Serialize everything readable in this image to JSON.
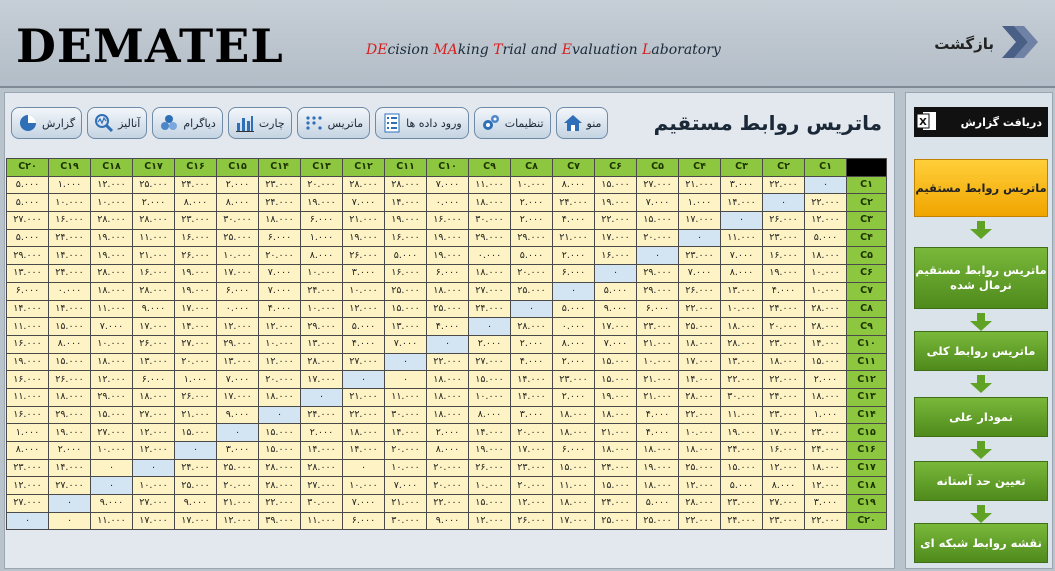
{
  "header": {
    "logo": "DEMATEL",
    "subtitle_parts": [
      {
        "t": "DE",
        "hl": true
      },
      {
        "t": "cision ",
        "hl": false
      },
      {
        "t": "MA",
        "hl": true
      },
      {
        "t": "king ",
        "hl": false
      },
      {
        "t": "T",
        "hl": true
      },
      {
        "t": "rial and ",
        "hl": false
      },
      {
        "t": "E",
        "hl": true
      },
      {
        "t": "valuation ",
        "hl": false
      },
      {
        "t": "L",
        "hl": true
      },
      {
        "t": "aboratory",
        "hl": false
      }
    ],
    "back_label": "بازگشت",
    "highlight_color": "#d81e1e"
  },
  "toolbar": [
    {
      "label": "منو",
      "icon": "home-icon"
    },
    {
      "label": "تنظیمات",
      "icon": "gears-icon"
    },
    {
      "label": "ورود داده ها",
      "icon": "form-icon"
    },
    {
      "label": "ماتریس",
      "icon": "matrix-dots-icon"
    },
    {
      "label": "چارت",
      "icon": "bar-chart-icon"
    },
    {
      "label": "دیاگرام",
      "icon": "diagram-icon"
    },
    {
      "label": "آنالیز",
      "icon": "analysis-icon"
    },
    {
      "label": "گزارش",
      "icon": "pie-chart-icon"
    }
  ],
  "page_title": "ماتریس روابط مستقیم",
  "sidebar": {
    "report_label": "دریافت گزارش",
    "steps": [
      {
        "label": "ماتریس روابط مستقیم",
        "active": true
      },
      {
        "label": "ماتریس روابط مستقیم نرمال شده",
        "active": false
      },
      {
        "label": "ماتریس روابط کلی",
        "active": false
      },
      {
        "label": "نمودار علی",
        "active": false
      },
      {
        "label": "تعیین حد آستانه",
        "active": false
      },
      {
        "label": "نقشه روابط شبکه ای",
        "active": false
      }
    ]
  },
  "matrix": {
    "columns": [
      "C۱",
      "C۲",
      "C۳",
      "C۴",
      "C۵",
      "C۶",
      "C۷",
      "C۸",
      "C۹",
      "C۱۰",
      "C۱۱",
      "C۱۲",
      "C۱۳",
      "C۱۴",
      "C۱۵",
      "C۱۶",
      "C۱۷",
      "C۱۸",
      "C۱۹",
      "C۲۰"
    ],
    "rows": [
      {
        "label": "C۱",
        "values": [
          "۰",
          "۲۲.۰۰۰",
          "۳.۰۰۰",
          "۲۱.۰۰۰",
          "۲۷.۰۰۰",
          "۱۵.۰۰۰",
          "۸.۰۰۰",
          "۱۰.۰۰۰",
          "۱۱.۰۰۰",
          "۷.۰۰۰",
          "۲۸.۰۰۰",
          "۲۸.۰۰۰",
          "۲۰.۰۰۰",
          "۲۳.۰۰۰",
          "۲.۰۰۰",
          "۲۴.۰۰۰",
          "۲۵.۰۰۰",
          "۱۲.۰۰۰",
          "۱.۰۰۰",
          "۵.۰۰۰"
        ]
      },
      {
        "label": "C۲",
        "values": [
          "۲۲.۰۰۰",
          "۰",
          "۱۴.۰۰۰",
          "۱.۰۰۰",
          "۷.۰۰۰",
          "۱۹.۰۰۰",
          "۲۴.۰۰۰",
          "۲.۰۰۰",
          "۱۸.۰۰۰",
          "۰.۰۰۰",
          "۱۴.۰۰۰",
          "۷.۰۰۰",
          "۱۹.۰۰۰",
          "۲۴.۰۰۰",
          "۸.۰۰۰",
          "۸.۰۰۰",
          "۲.۰۰۰",
          "۱۰.۰۰۰",
          "۱۰.۰۰۰",
          "۵.۰۰۰"
        ]
      },
      {
        "label": "C۳",
        "values": [
          "۱۲.۰۰۰",
          "۲۶.۰۰۰",
          "۰",
          "۱۷.۰۰۰",
          "۱۵.۰۰۰",
          "۲۲.۰۰۰",
          "۴.۰۰۰",
          "۲.۰۰۰",
          "۳۰.۰۰۰",
          "۱۶.۰۰۰",
          "۱۹.۰۰۰",
          "۲۱.۰۰۰",
          "۶.۰۰۰",
          "۱۸.۰۰۰",
          "۳۰.۰۰۰",
          "۲۳.۰۰۰",
          "۲۸.۰۰۰",
          "۲۸.۰۰۰",
          "۱۶.۰۰۰",
          "۲۷.۰۰۰"
        ]
      },
      {
        "label": "C۴",
        "values": [
          "۵.۰۰۰",
          "۲۳.۰۰۰",
          "۱۱.۰۰۰",
          "۰",
          "۲۰.۰۰۰",
          "۱۷.۰۰۰",
          "۲۱.۰۰۰",
          "۲۹.۰۰۰",
          "۲۹.۰۰۰",
          "۱۹.۰۰۰",
          "۱۶.۰۰۰",
          "۱۹.۰۰۰",
          "۱.۰۰۰",
          "۶.۰۰۰",
          "۲۵.۰۰۰",
          "۱۶.۰۰۰",
          "۱۱.۰۰۰",
          "۱۹.۰۰۰",
          "۲۴.۰۰۰",
          "۵.۰۰۰"
        ]
      },
      {
        "label": "C۵",
        "values": [
          "۱۸.۰۰۰",
          "۱۶.۰۰۰",
          "۷.۰۰۰",
          "۲۳.۰۰۰",
          "۰",
          "۱۶.۰۰۰",
          "۲.۰۰۰",
          "۵.۰۰۰",
          "۰.۰۰۰",
          "۱۹.۰۰۰",
          "۵.۰۰۰",
          "۲۶.۰۰۰",
          "۸.۰۰۰",
          "۲۰.۰۰۰",
          "۱۰.۰۰۰",
          "۲۶.۰۰۰",
          "۲۱.۰۰۰",
          "۱۹.۰۰۰",
          "۱۴.۰۰۰",
          "۲۹.۰۰۰"
        ]
      },
      {
        "label": "C۶",
        "values": [
          "۱۰.۰۰۰",
          "۱۹.۰۰۰",
          "۸.۰۰۰",
          "۷.۰۰۰",
          "۲۹.۰۰۰",
          "۰",
          "۶.۰۰۰",
          "۲۰.۰۰۰",
          "۱۸.۰۰۰",
          "۶.۰۰۰",
          "۱۶.۰۰۰",
          "۳.۰۰۰",
          "۱۰.۰۰۰",
          "۷.۰۰۰",
          "۱۷.۰۰۰",
          "۱۹.۰۰۰",
          "۱۶.۰۰۰",
          "۲۸.۰۰۰",
          "۲۴.۰۰۰",
          "۱۳.۰۰۰"
        ]
      },
      {
        "label": "C۷",
        "values": [
          "۱۰.۰۰۰",
          "۴.۰۰۰",
          "۱۳.۰۰۰",
          "۲۶.۰۰۰",
          "۲۹.۰۰۰",
          "۵.۰۰۰",
          "۰",
          "۲۵.۰۰۰",
          "۲۷.۰۰۰",
          "۱۸.۰۰۰",
          "۲۵.۰۰۰",
          "۱۰.۰۰۰",
          "۲۴.۰۰۰",
          "۷.۰۰۰",
          "۶.۰۰۰",
          "۱۹.۰۰۰",
          "۲۸.۰۰۰",
          "۱۸.۰۰۰",
          "۰.۰۰۰",
          "۶.۰۰۰"
        ]
      },
      {
        "label": "C۸",
        "values": [
          "۲۸.۰۰۰",
          "۲۴.۰۰۰",
          "۱۰.۰۰۰",
          "۲۲.۰۰۰",
          "۶.۰۰۰",
          "۹.۰۰۰",
          "۵.۰۰۰",
          "۰",
          "۲۴.۰۰۰",
          "۲۵.۰۰۰",
          "۱۵.۰۰۰",
          "۱۲.۰۰۰",
          "۱۰.۰۰۰",
          "۴.۰۰۰",
          "۰.۰۰۰",
          "۱۷.۰۰۰",
          "۹.۰۰۰",
          "۱۱.۰۰۰",
          "۱۴.۰۰۰",
          "۱۴.۰۰۰"
        ]
      },
      {
        "label": "C۹",
        "values": [
          "۲۸.۰۰۰",
          "۲۰.۰۰۰",
          "۱۸.۰۰۰",
          "۲۵.۰۰۰",
          "۲۳.۰۰۰",
          "۱۷.۰۰۰",
          "۰.۰۰۰",
          "۲۸.۰۰۰",
          "۰",
          "۴.۰۰۰",
          "۱۳.۰۰۰",
          "۵.۰۰۰",
          "۲۹.۰۰۰",
          "۱۲.۰۰۰",
          "۱۲.۰۰۰",
          "۱۴.۰۰۰",
          "۱۷.۰۰۰",
          "۷.۰۰۰",
          "۱۵.۰۰۰",
          "۱۱.۰۰۰"
        ]
      },
      {
        "label": "C۱۰",
        "values": [
          "۱۴.۰۰۰",
          "۲۳.۰۰۰",
          "۲۸.۰۰۰",
          "۱۸.۰۰۰",
          "۲۱.۰۰۰",
          "۷.۰۰۰",
          "۸.۰۰۰",
          "۲.۰۰۰",
          "۲.۰۰۰",
          "۰",
          "۷.۰۰۰",
          "۴.۰۰۰",
          "۱۳.۰۰۰",
          "۱۰.۰۰۰",
          "۲۹.۰۰۰",
          "۲۷.۰۰۰",
          "۲۶.۰۰۰",
          "۱۰.۰۰۰",
          "۸.۰۰۰",
          "۱۶.۰۰۰"
        ]
      },
      {
        "label": "C۱۱",
        "values": [
          "۱۵.۰۰۰",
          "۱۸.۰۰۰",
          "۱۳.۰۰۰",
          "۱۷.۰۰۰",
          "۱۰.۰۰۰",
          "۱۵.۰۰۰",
          "۲.۰۰۰",
          "۴.۰۰۰",
          "۲۷.۰۰۰",
          "۲۲.۰۰۰",
          "۰",
          "۲۷.۰۰۰",
          "۲۸.۰۰۰",
          "۱۲.۰۰۰",
          "۱۳.۰۰۰",
          "۲۰.۰۰۰",
          "۱۳.۰۰۰",
          "۱۸.۰۰۰",
          "۱۵.۰۰۰",
          "۱۹.۰۰۰"
        ]
      },
      {
        "label": "C۱۲",
        "values": [
          "۲.۰۰۰",
          "۲۲.۰۰۰",
          "۲۲.۰۰۰",
          "۱۴.۰۰۰",
          "۲۱.۰۰۰",
          "۱۵.۰۰۰",
          "۲۳.۰۰۰",
          "۱۴.۰۰۰",
          "۱۵.۰۰۰",
          "۱۸.۰۰۰",
          "۰",
          "۰",
          "۱۷.۰۰۰",
          "۲۰.۰۰۰",
          "۷.۰۰۰",
          "۱.۰۰۰",
          "۶.۰۰۰",
          "۱۲.۰۰۰",
          "۲۶.۰۰۰",
          "۱۶.۰۰۰"
        ]
      },
      {
        "label": "C۱۳",
        "values": [
          "۱۸.۰۰۰",
          "۲۴.۰۰۰",
          "۳۰.۰۰۰",
          "۲۸.۰۰۰",
          "۲۱.۰۰۰",
          "۱۹.۰۰۰",
          "۲.۰۰۰",
          "۱۴.۰۰۰",
          "۱۰.۰۰۰",
          "۱۸.۰۰۰",
          "۱۱.۰۰۰",
          "۲۱.۰۰۰",
          "۰",
          "۱۸.۰۰۰",
          "۱۷.۰۰۰",
          "۲۶.۰۰۰",
          "۱۸.۰۰۰",
          "۲۹.۰۰۰",
          "۱۸.۰۰۰",
          "۱۱.۰۰۰"
        ]
      },
      {
        "label": "C۱۴",
        "values": [
          "۱.۰۰۰",
          "۲۳.۰۰۰",
          "۱۱.۰۰۰",
          "۲۲.۰۰۰",
          "۴.۰۰۰",
          "۱۸.۰۰۰",
          "۱۸.۰۰۰",
          "۳.۰۰۰",
          "۸.۰۰۰",
          "۱۸.۰۰۰",
          "۳۰.۰۰۰",
          "۲۲.۰۰۰",
          "۲۴.۰۰۰",
          "۰",
          "۹.۰۰۰",
          "۲۱.۰۰۰",
          "۲۷.۰۰۰",
          "۱۵.۰۰۰",
          "۲۹.۰۰۰",
          "۱۶.۰۰۰"
        ]
      },
      {
        "label": "C۱۵",
        "values": [
          "۲۳.۰۰۰",
          "۱۷.۰۰۰",
          "۱۹.۰۰۰",
          "۱۰.۰۰۰",
          "۴.۰۰۰",
          "۲۱.۰۰۰",
          "۱۸.۰۰۰",
          "۲۰.۰۰۰",
          "۱۴.۰۰۰",
          "۲.۰۰۰",
          "۱۴.۰۰۰",
          "۱۸.۰۰۰",
          "۲.۰۰۰",
          "۱۵.۰۰۰",
          "۰",
          "۱۵.۰۰۰",
          "۱۲.۰۰۰",
          "۲۷.۰۰۰",
          "۱۹.۰۰۰",
          "۱.۰۰۰"
        ]
      },
      {
        "label": "C۱۶",
        "values": [
          "۲۴.۰۰۰",
          "۱۶.۰۰۰",
          "۲۴.۰۰۰",
          "۱۸.۰۰۰",
          "۱۸.۰۰۰",
          "۱۸.۰۰۰",
          "۶.۰۰۰",
          "۱۷.۰۰۰",
          "۱۹.۰۰۰",
          "۸.۰۰۰",
          "۲۰.۰۰۰",
          "۱۴.۰۰۰",
          "۱۴.۰۰۰",
          "۱۵.۰۰۰",
          "۳.۰۰۰",
          "۰",
          "۱۲.۰۰۰",
          "۱۰.۰۰۰",
          "۲.۰۰۰",
          "۸.۰۰۰"
        ]
      },
      {
        "label": "C۱۷",
        "values": [
          "۱۸.۰۰۰",
          "۱۲.۰۰۰",
          "۱۵.۰۰۰",
          "۲۵.۰۰۰",
          "۱۹.۰۰۰",
          "۲۴.۰۰۰",
          "۱۵.۰۰۰",
          "۲۳.۰۰۰",
          "۲۶.۰۰۰",
          "۲۰.۰۰۰",
          "۱۰.۰۰۰",
          "۰",
          "۲۸.۰۰۰",
          "۲۸.۰۰۰",
          "۲۵.۰۰۰",
          "۲۴.۰۰۰",
          "۰",
          "۰",
          "۱۴.۰۰۰",
          "۲۳.۰۰۰"
        ]
      },
      {
        "label": "C۱۸",
        "values": [
          "۱۲.۰۰۰",
          "۸.۰۰۰",
          "۵.۰۰۰",
          "۱۲.۰۰۰",
          "۱۸.۰۰۰",
          "۱۵.۰۰۰",
          "۱۱.۰۰۰",
          "۲۰.۰۰۰",
          "۱۰.۰۰۰",
          "۲۰.۰۰۰",
          "۷.۰۰۰",
          "۱۰.۰۰۰",
          "۲۷.۰۰۰",
          "۲۸.۰۰۰",
          "۲۰.۰۰۰",
          "۲۵.۰۰۰",
          "۱۰.۰۰۰",
          "۰",
          "۲۷.۰۰۰",
          "۱۲.۰۰۰"
        ]
      },
      {
        "label": "C۱۹",
        "values": [
          "۳.۰۰۰",
          "۲۷.۰۰۰",
          "۲۳.۰۰۰",
          "۲۸.۰۰۰",
          "۵.۰۰۰",
          "۲۴.۰۰۰",
          "۱۸.۰۰۰",
          "۱۲.۰۰۰",
          "۱۵.۰۰۰",
          "۲۲.۰۰۰",
          "۲۱.۰۰۰",
          "۷.۰۰۰",
          "۳۰.۰۰۰",
          "۲۲.۰۰۰",
          "۲۱.۰۰۰",
          "۹.۰۰۰",
          "۲۷.۰۰۰",
          "۹.۰۰۰",
          "۰",
          "۲۷.۰۰۰"
        ]
      },
      {
        "label": "C۲۰",
        "values": [
          "۲۲.۰۰۰",
          "۲۳.۰۰۰",
          "۲۴.۰۰۰",
          "۲۲.۰۰۰",
          "۲۵.۰۰۰",
          "۲۵.۰۰۰",
          "۱۷.۰۰۰",
          "۲۶.۰۰۰",
          "۱۲.۰۰۰",
          "۹.۰۰۰",
          "۳۰.۰۰۰",
          "۶.۰۰۰",
          "۱۱.۰۰۰",
          "۳۹.۰۰۰",
          "۱۲.۰۰۰",
          "۱۷.۰۰۰",
          "۱۷.۰۰۰",
          "۱۱.۰۰۰",
          "۰",
          "۰"
        ]
      }
    ]
  }
}
